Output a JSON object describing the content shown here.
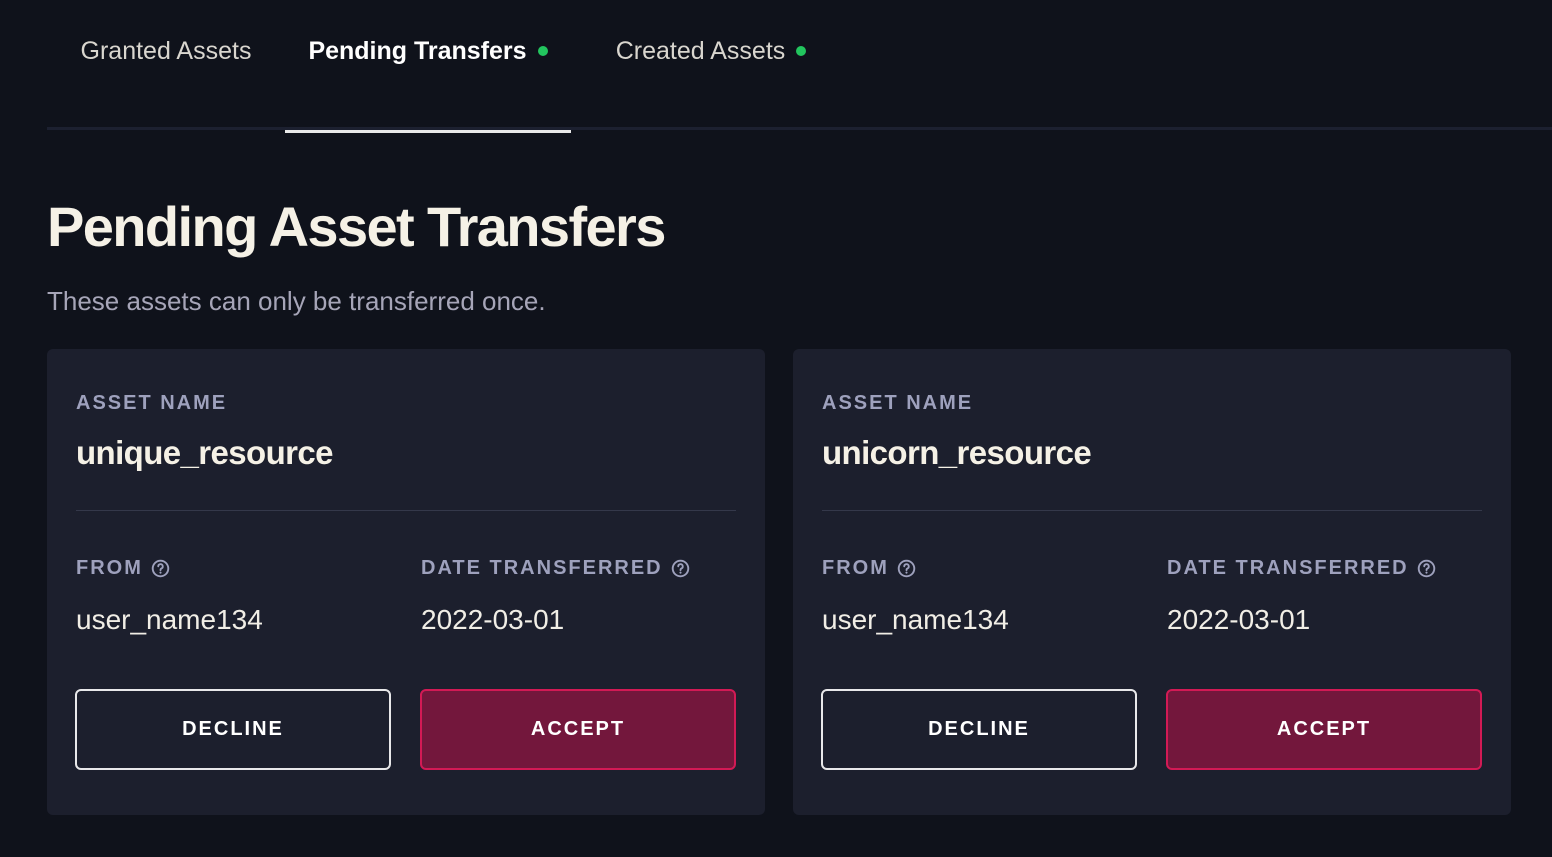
{
  "tabs": [
    {
      "label": "Granted Assets",
      "has_dot": false,
      "active": false
    },
    {
      "label": "Pending Transfers",
      "has_dot": true,
      "active": true
    },
    {
      "label": "Created Assets",
      "has_dot": true,
      "active": false
    }
  ],
  "colors": {
    "status_dot": "#22c55e",
    "accept_bg": "#73173c",
    "accept_border": "#d21a55",
    "background": "#0f121b",
    "card_bg": "#1c1f2d"
  },
  "page": {
    "title": "Pending Asset Transfers",
    "subtitle": "These assets can only be transferred once."
  },
  "cards": [
    {
      "asset_name_label": "ASSET NAME",
      "asset_name": "unique_resource",
      "from_label": "FROM",
      "from_value": "user_name134",
      "date_label": "DATE TRANSFERRED",
      "date_value": "2022-03-01",
      "decline_label": "DECLINE",
      "accept_label": "ACCEPT"
    },
    {
      "asset_name_label": "ASSET NAME",
      "asset_name": "unicorn_resource",
      "from_label": "FROM",
      "from_value": "user_name134",
      "date_label": "DATE TRANSFERRED",
      "date_value": "2022-03-01",
      "decline_label": "DECLINE",
      "accept_label": "ACCEPT"
    }
  ],
  "icons": {
    "help": "question-circle-icon"
  }
}
